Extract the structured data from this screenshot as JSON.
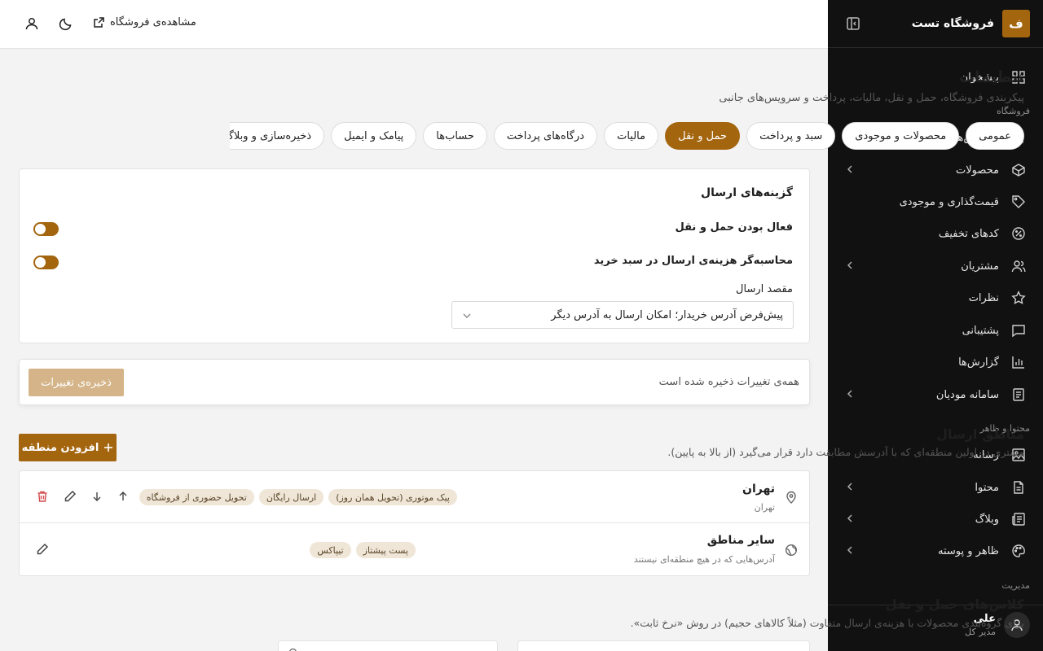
{
  "sidebar": {
    "brand_letter": "ف",
    "brand_name": "فروشگاه تست",
    "sections": {
      "store": "فروشگاه",
      "content": "محتوا و ظاهر",
      "admin": "مدیریت"
    },
    "items": [
      {
        "label": "پیشخوان",
        "icon": "dashboard-icon"
      },
      {
        "label": "سفارش‌ها",
        "icon": "orders-icon"
      },
      {
        "label": "محصولات",
        "icon": "box-icon"
      },
      {
        "label": "قیمت‌گذاری و موجودی",
        "icon": "tag-icon"
      },
      {
        "label": "کدهای تخفیف",
        "icon": "percent-icon"
      },
      {
        "label": "مشتریان",
        "icon": "users-icon"
      },
      {
        "label": "نظرات",
        "icon": "star-icon"
      },
      {
        "label": "پشتیبانی",
        "icon": "chat-icon"
      },
      {
        "label": "گزارش‌ها",
        "icon": "chart-icon"
      },
      {
        "label": "سامانه مودیان",
        "icon": "document-icon"
      },
      {
        "label": "رسانه",
        "icon": "image-icon"
      },
      {
        "label": "محتوا",
        "icon": "file-icon"
      },
      {
        "label": "وبلاگ",
        "icon": "newspaper-icon"
      },
      {
        "label": "ظاهر و پوسته",
        "icon": "palette-icon"
      }
    ],
    "user": {
      "name": "علی",
      "role": "مدیر کل"
    }
  },
  "topbar": {
    "view_store": "مشاهده‌ی فروشگاه"
  },
  "page": {
    "title": "تنظیمات",
    "subtitle": "پیکربندی فروشگاه، حمل و نقل، مالیات، پرداخت و سرویس‌های جانبی"
  },
  "tabs": [
    "عمومی",
    "محصولات و موجودی",
    "سبد و پرداخت",
    "حمل و نقل",
    "مالیات",
    "درگاه‌های پرداخت",
    "حساب‌ها",
    "پیامک و ایمیل",
    "ذخیره‌سازی و وبلاگ",
    "…"
  ],
  "shipping_options": {
    "title": "گزینه‌های ارسال",
    "enable_shipping": "فعال بودن حمل و نقل",
    "cart_calculator": "محاسبه‌گر هزینه‌ی ارسال در سبد خرید",
    "destination_label": "مقصد ارسال",
    "destination_value": "پیش‌فرض آدرس خریدار؛ امکان ارسال به آدرس دیگر"
  },
  "save_bar": {
    "status": "همه‌ی تغییرات ذخیره شده است",
    "button": "ذخیره‌ی تغییرات"
  },
  "zones": {
    "title": "مناطق ارسال",
    "subtitle": "مشتری در اولین منطقه‌ای که با آدرسش مطابقت دارد قرار می‌گیرد (از بالا به پایین).",
    "add_button": "افزودن منطقه",
    "rows": [
      {
        "name": "تهران",
        "desc": "تهران",
        "chips": [
          "پیک موتوری (تحویل همان روز)",
          "ارسال رایگان",
          "تحویل حضوری از فروشگاه"
        ]
      },
      {
        "name": "سایر مناطق",
        "desc": "آدرس‌هایی که در هیچ منطقه‌ای نیستند",
        "chips": [
          "پست پیشتاز",
          "تیپاکس"
        ]
      }
    ]
  },
  "classes": {
    "title": "کلاس‌های حمل و نقل",
    "subtitle": "برای گروه‌بندی محصولات با هزینه‌ی ارسال متفاوت (مثلاً کالاهای حجیم) در روش «نرخ ثابت»."
  },
  "colors": {
    "accent": "#a4650f",
    "accent_light": "#d4b488",
    "sidebar_bg": "#111111"
  }
}
